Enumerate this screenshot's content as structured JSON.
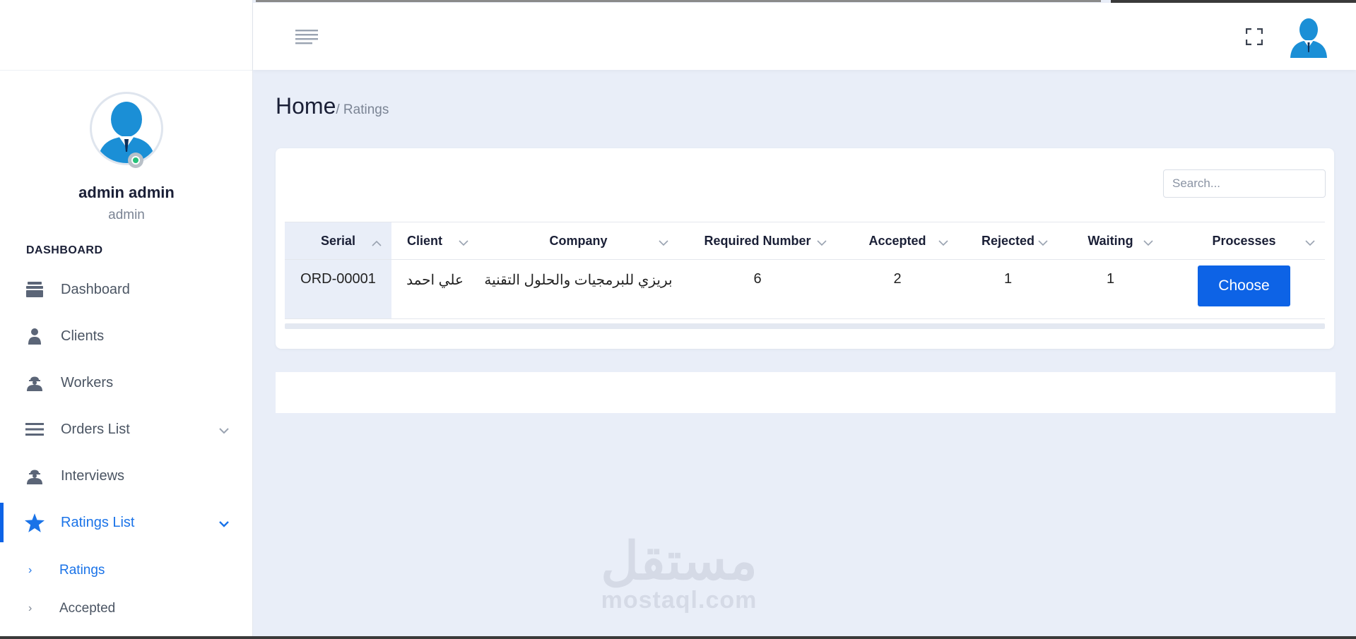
{
  "profile": {
    "name": "admin admin",
    "role": "admin"
  },
  "sidebar": {
    "section_title": "DASHBOARD",
    "items": [
      {
        "label": "Dashboard",
        "icon": "layers-icon"
      },
      {
        "label": "Clients",
        "icon": "user-icon"
      },
      {
        "label": "Workers",
        "icon": "worker-icon"
      },
      {
        "label": "Orders List",
        "icon": "list-icon",
        "expandable": true
      },
      {
        "label": "Interviews",
        "icon": "worker-icon"
      },
      {
        "label": "Ratings List",
        "icon": "star-icon",
        "expandable": true,
        "active": true
      }
    ],
    "subitems": [
      {
        "label": "Ratings",
        "active": true
      },
      {
        "label": "Accepted"
      }
    ]
  },
  "breadcrumb": {
    "home": "Home",
    "current": "/ Ratings"
  },
  "search": {
    "placeholder": "Search..."
  },
  "table": {
    "columns": [
      "Serial",
      "Client",
      "Company",
      "Required Number",
      "Accepted",
      "Rejected",
      "Waiting",
      "Processes"
    ],
    "rows": [
      {
        "serial": "ORD-00001",
        "client": "علي احمد",
        "company": "بريزي للبرمجيات والحلول التقنية",
        "required_number": "6",
        "accepted": "2",
        "rejected": "1",
        "waiting": "1",
        "action_label": "Choose"
      }
    ]
  },
  "watermark": {
    "arabic": "مستقل",
    "latin": "mostaql.com"
  },
  "colors": {
    "accent": "#0d63e6",
    "background": "#e9eef8",
    "online": "#27c27a"
  }
}
